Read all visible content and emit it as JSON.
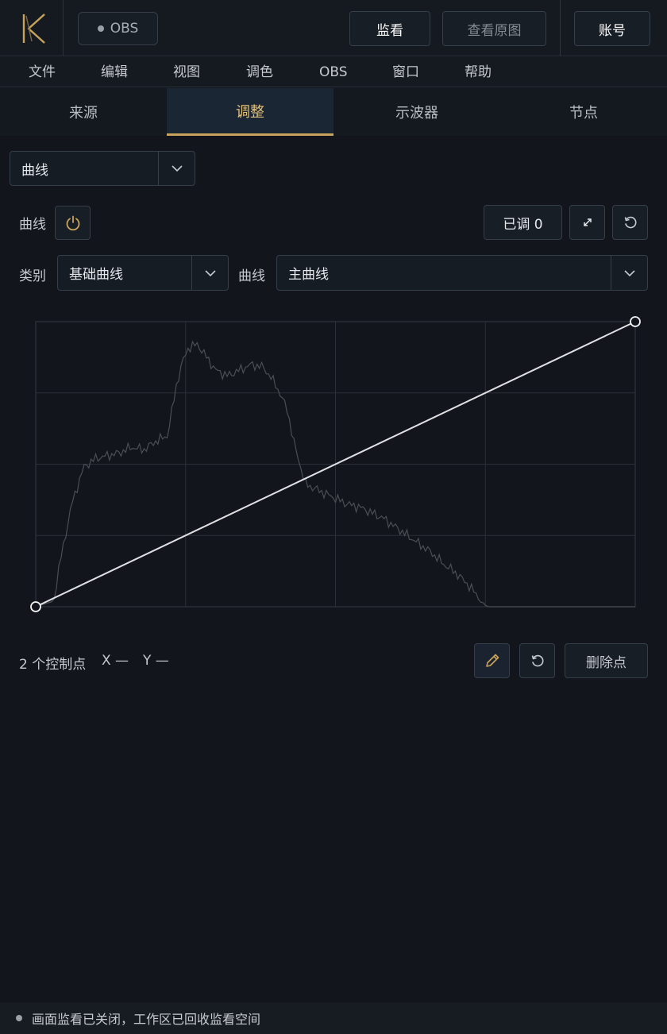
{
  "header": {
    "obs_label": "OBS",
    "monitor_label": "监看",
    "original_label": "查看原图",
    "account_label": "账号"
  },
  "menu": [
    "文件",
    "编辑",
    "视图",
    "调色",
    "OBS",
    "窗口",
    "帮助"
  ],
  "tabs": [
    {
      "label": "来源",
      "active": false
    },
    {
      "label": "调整",
      "active": true
    },
    {
      "label": "示波器",
      "active": false
    },
    {
      "label": "节点",
      "active": false
    }
  ],
  "panel": {
    "tool_select": "曲线",
    "curve_label": "曲线",
    "adjusted_label": "已调 0",
    "category_label": "类别",
    "category_value": "基础曲线",
    "curve_select_label": "曲线",
    "curve_select_value": "主曲线"
  },
  "curve_editor": {
    "control_points": [
      [
        0,
        0
      ],
      [
        1,
        1
      ]
    ],
    "grid_divisions": 4
  },
  "footer": {
    "points_info": "2 个控制点",
    "x_readout": "X —",
    "y_readout": "Y —",
    "delete_point_label": "删除点"
  },
  "status": {
    "text": "画面监看已关闭，工作区已回收监看空间"
  },
  "colors": {
    "accent": "#c9a35a",
    "background": "#12151b",
    "active_tab_bg": "#1b2634"
  }
}
